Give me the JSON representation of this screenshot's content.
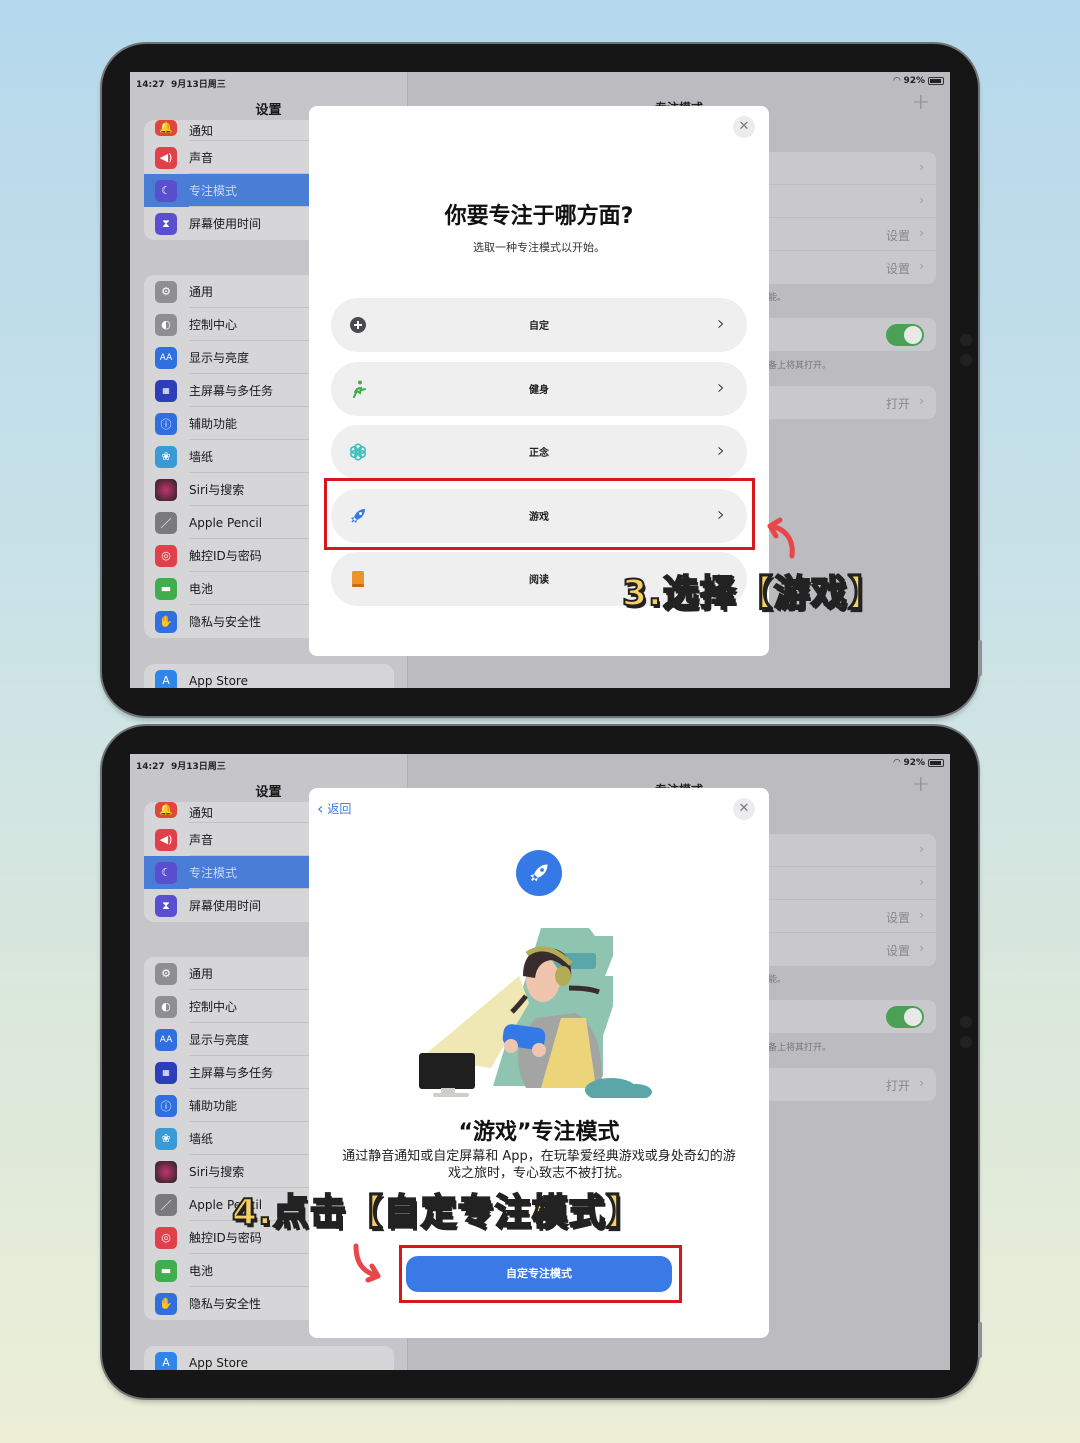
{
  "status_bar": {
    "time": "14:27",
    "date": "9月13日周三",
    "wifi_icon": "wifi-icon",
    "battery_percent": "92%",
    "battery_level": 0.92
  },
  "sidebar": {
    "title": "设置",
    "group1": [
      {
        "label": "通知",
        "icon": "bell-icon",
        "color": "#e0473a"
      },
      {
        "label": "声音",
        "icon": "speaker-icon",
        "color": "#e0404a"
      },
      {
        "label": "专注模式",
        "icon": "moon-icon",
        "color": "#5a4fcf",
        "selected": true
      },
      {
        "label": "屏幕使用时间",
        "icon": "hourglass-icon",
        "color": "#5a4fcf"
      }
    ],
    "group2": [
      {
        "label": "通用",
        "icon": "gear-icon",
        "color": "#8e8e93"
      },
      {
        "label": "控制中心",
        "icon": "toggles-icon",
        "color": "#8e8e93"
      },
      {
        "label": "显示与亮度",
        "icon": "text-size-icon",
        "color": "#2f6fe0",
        "glyph": "AA"
      },
      {
        "label": "主屏幕与多任务",
        "icon": "grid-icon",
        "color": "#2c3fb8"
      },
      {
        "label": "辅助功能",
        "icon": "accessibility-icon",
        "color": "#2f6fe0"
      },
      {
        "label": "墙纸",
        "icon": "flower-icon",
        "color": "#3a9ad6"
      },
      {
        "label": "Siri与搜索",
        "icon": "siri-icon",
        "color": "#222222"
      },
      {
        "label": "Apple Pencil",
        "icon": "pencil-icon",
        "color": "#7a7a7e"
      },
      {
        "label": "触控ID与密码",
        "icon": "fingerprint-icon",
        "color": "#e0404a"
      },
      {
        "label": "电池",
        "icon": "battery-icon",
        "color": "#3fae4c"
      },
      {
        "label": "隐私与安全性",
        "icon": "hand-icon",
        "color": "#2f6fe0"
      }
    ],
    "group3": [
      {
        "label": "App Store",
        "icon": "app-store-icon",
        "color": "#2f86e8"
      }
    ]
  },
  "detail": {
    "header": "专注模式",
    "add_icon": "plus-icon",
    "rows": [
      {
        "value": ""
      },
      {
        "value": ""
      },
      {
        "value": "设置"
      },
      {
        "value": "设置"
      }
    ],
    "note1": "能。",
    "toggle_on": true,
    "note2": "备上将其打开。",
    "open_row_value": "打开"
  },
  "step3": {
    "modal_title": "你要专注于哪方面?",
    "modal_subtitle": "选取一种专注模式以开始。",
    "close_icon": "close-icon",
    "options": [
      {
        "label": "自定",
        "icon": "plus-circle-icon",
        "color": "#4a4a4e"
      },
      {
        "label": "健身",
        "icon": "running-icon",
        "color": "#3fae4c"
      },
      {
        "label": "正念",
        "icon": "flower-icon",
        "color": "#3bbfc0"
      },
      {
        "label": "游戏",
        "icon": "rocket-icon",
        "color": "#3579e6",
        "highlighted": true
      },
      {
        "label": "阅读",
        "icon": "book-icon",
        "color": "#f0922b"
      }
    ],
    "annotation": "3.选择【游戏】"
  },
  "step4": {
    "back_label": "返回",
    "close_icon": "close-icon",
    "badge_icon": "rocket-icon",
    "title": "“游戏”专注模式",
    "description": "通过静音通知或自定屏幕和 App，在玩挚爱经典游戏或身处奇幻的游戏之旅时，专心致志不被打扰。",
    "button_label": "自定专注模式",
    "annotation": "4.点击【自定专注模式】"
  },
  "colors": {
    "accent": "#3579e6",
    "highlight_red": "#d9161d",
    "annotation_yellow": "#f6d064",
    "toggle_green": "#4aa055"
  }
}
